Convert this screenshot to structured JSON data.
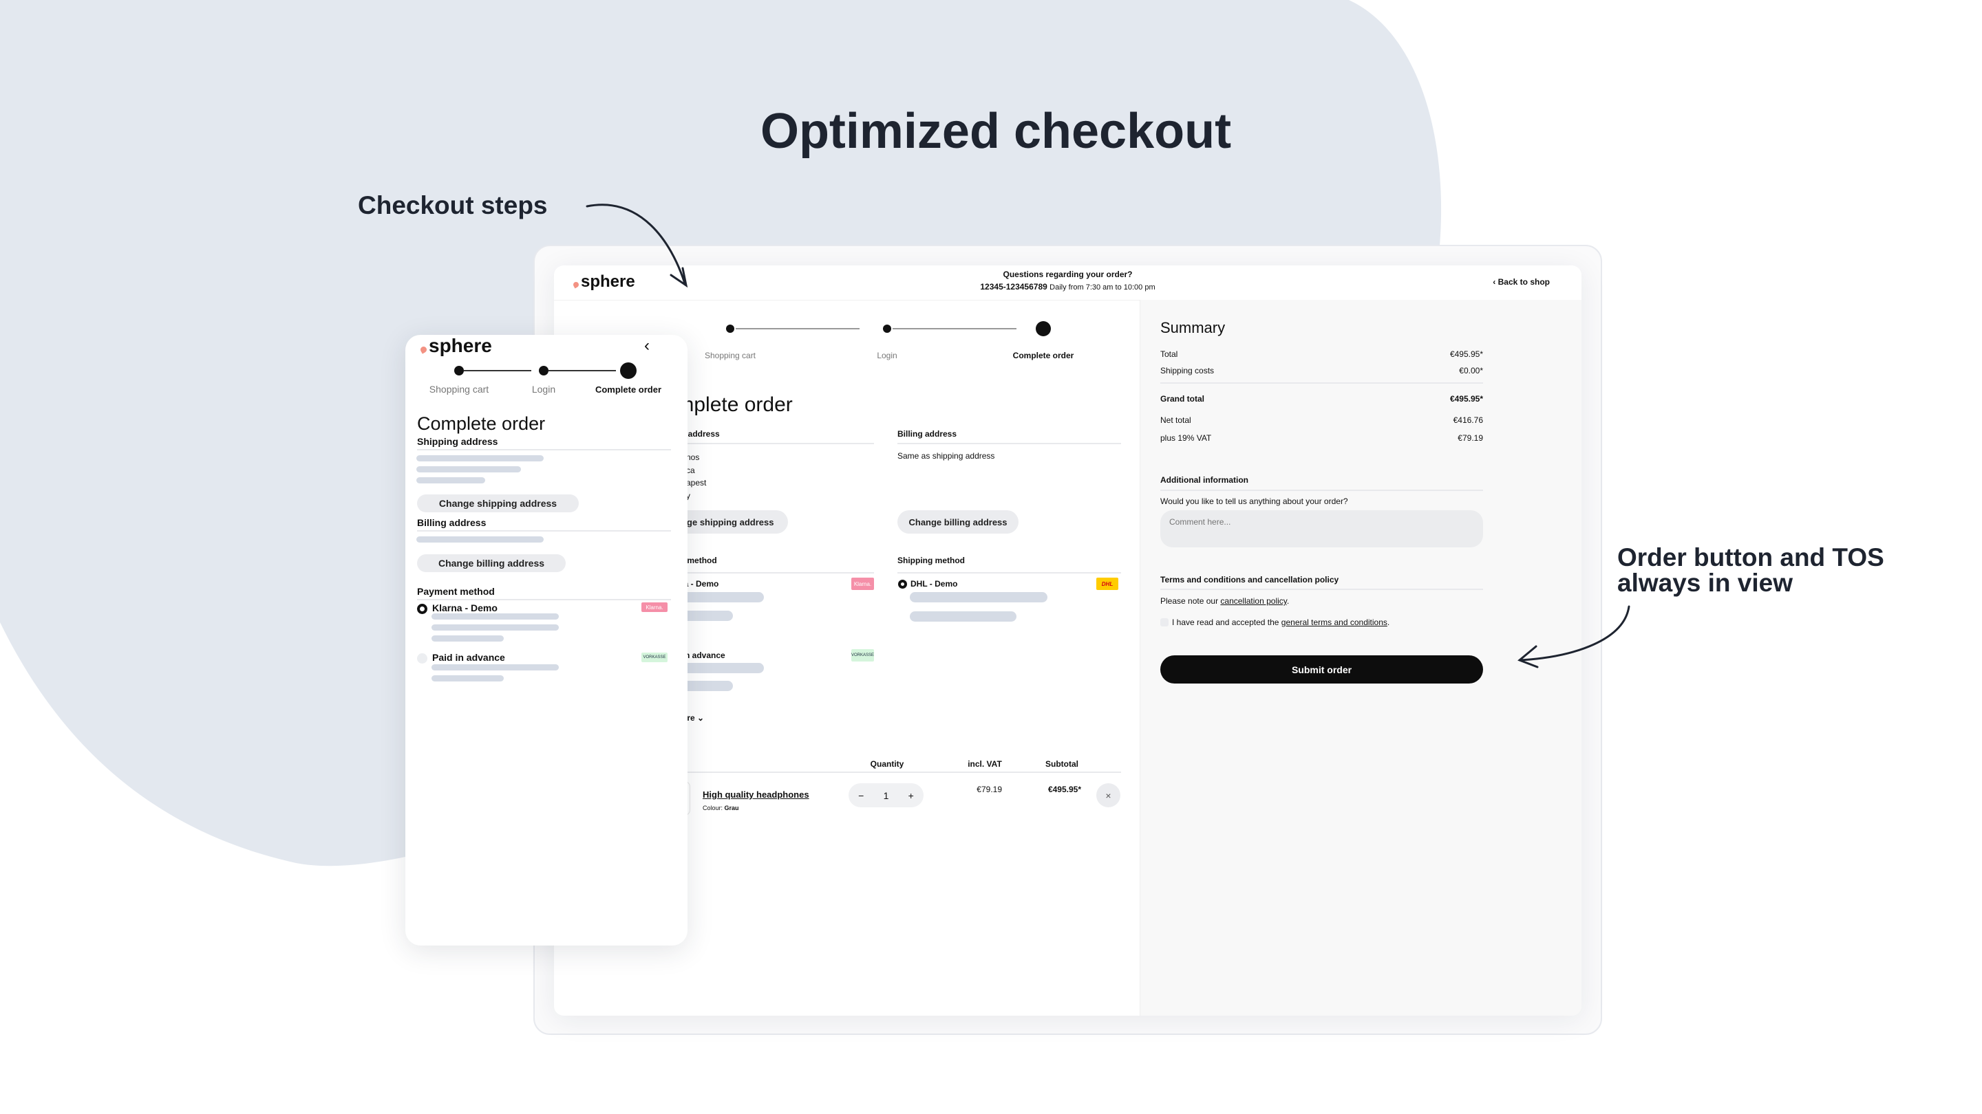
{
  "headline": "Optimized checkout",
  "annotations": {
    "steps": "Checkout steps",
    "order_line1": "Order button and TOS",
    "order_line2": "always in view"
  },
  "colors": {
    "blob": "#e3e8ef",
    "headline": "#1e2430",
    "logo_accent": "#f39283",
    "skeleton": "#d5dbe5",
    "button_bg": "#ebecef",
    "submit_bg": "#0d0d0d",
    "klarna": "#f58fa8",
    "vorkasse": "#d5f5dc",
    "dhl": "#ffcc00"
  },
  "desktop": {
    "logo": "sphere",
    "help": {
      "question": "Questions regarding your order?",
      "phone": "12345-123456789",
      "hours": "Daily from 7:30 am to 10:00 pm"
    },
    "back": "Back to shop",
    "steps": [
      {
        "label": "Shopping cart"
      },
      {
        "label": "Login"
      },
      {
        "label": "Complete order"
      }
    ],
    "title": "Complete order",
    "shipping_address": {
      "heading": "Shipping address",
      "lines": [
        "nos",
        "ca",
        "apest",
        "y"
      ],
      "button": "Change shipping address"
    },
    "billing_address": {
      "heading": "Billing address",
      "text": "Same as shipping address",
      "button": "Change billing address"
    },
    "payment": {
      "heading": "Payment method",
      "options": [
        {
          "label": "Klarna - Demo",
          "badge": "Klarna."
        },
        {
          "label": "Paid in advance",
          "badge": "VORKASSE"
        }
      ],
      "show_more": "Show more"
    },
    "shipping_method": {
      "heading": "Shipping method",
      "option": "DHL - Demo",
      "badge": "DHL"
    },
    "cart": {
      "headers": {
        "quantity": "Quantity",
        "vat": "incl. VAT",
        "subtotal": "Subtotal"
      },
      "item": {
        "name": "High quality headphones",
        "variant_label": "Colour:",
        "variant_value": "Grau",
        "quantity": "1",
        "vat": "€79.19",
        "subtotal": "€495.95*"
      }
    },
    "summary": {
      "title": "Summary",
      "total": {
        "label": "Total",
        "value": "€495.95*"
      },
      "shipping": {
        "label": "Shipping costs",
        "value": "€0.00*"
      },
      "grand": {
        "label": "Grand total",
        "value": "€495.95*"
      },
      "net": {
        "label": "Net total",
        "value": "€416.76"
      },
      "vat": {
        "label": "plus 19% VAT",
        "value": "€79.19"
      },
      "additional": {
        "heading": "Additional information",
        "question": "Would you like to tell us anything about your order?",
        "placeholder": "Comment here..."
      },
      "terms": {
        "heading": "Terms and conditions and cancellation policy",
        "note_prefix": "Please note our ",
        "note_link": "cancellation policy",
        "note_suffix": ".",
        "accept_prefix": "I have read and accepted the ",
        "accept_link": "general terms and conditions",
        "accept_suffix": ".",
        "accepted": false
      },
      "submit": "Submit order"
    }
  },
  "mobile": {
    "logo": "sphere",
    "steps": [
      {
        "label": "Shopping cart"
      },
      {
        "label": "Login"
      },
      {
        "label": "Complete order"
      }
    ],
    "title": "Complete order",
    "shipping_heading": "Shipping address",
    "shipping_button": "Change shipping address",
    "billing_heading": "Billing address",
    "billing_button": "Change billing address",
    "payment_heading": "Payment method",
    "options": [
      {
        "label": "Klarna - Demo",
        "badge": "Klarna."
      },
      {
        "label": "Paid in advance",
        "badge": "VORKASSE"
      }
    ]
  }
}
